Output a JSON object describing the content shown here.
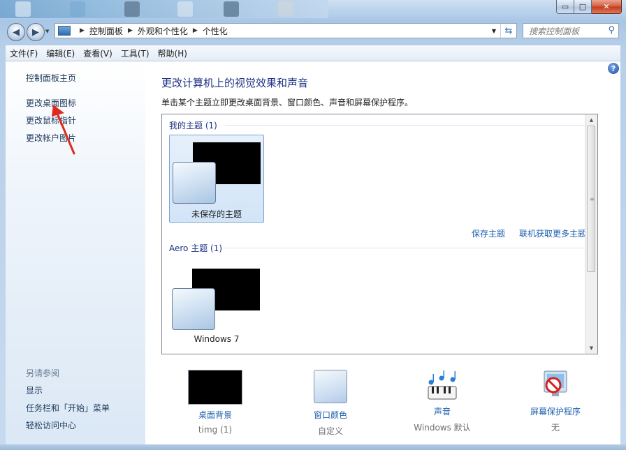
{
  "window": {
    "caption_buttons": {
      "minimize": "▭",
      "maximize": "□",
      "close": "✕"
    }
  },
  "navigation": {
    "back_icon": "◀",
    "forward_icon": "▶",
    "breadcrumbs": [
      "控制面板",
      "外观和个性化",
      "个性化"
    ],
    "search_placeholder": "搜索控制面板"
  },
  "menubar": {
    "items": [
      "文件(F)",
      "编辑(E)",
      "查看(V)",
      "工具(T)",
      "帮助(H)"
    ]
  },
  "sidebar": {
    "home": "控制面板主页",
    "links": [
      "更改桌面图标",
      "更改鼠标指针",
      "更改帐户图片"
    ],
    "see_also_header": "另请参阅",
    "see_also": [
      "显示",
      "任务栏和「开始」菜单",
      "轻松访问中心"
    ]
  },
  "main": {
    "title": "更改计算机上的视觉效果和声音",
    "description": "单击某个主题立即更改桌面背景、窗口颜色、声音和屏幕保护程序。",
    "my_themes": {
      "header": "我的主题 (1)",
      "themes": [
        {
          "label": "未保存的主题",
          "selected": true
        }
      ],
      "save_link": "保存主题",
      "online_link": "联机获取更多主题"
    },
    "aero_themes": {
      "header": "Aero 主题 (1)",
      "themes": [
        {
          "label": "Windows 7",
          "selected": false
        }
      ]
    },
    "help_icon": "?"
  },
  "bottom": [
    {
      "name": "桌面背景",
      "value": "timg (1)",
      "icon": "black-wallpaper-thumbnail"
    },
    {
      "name": "窗口颜色",
      "value": "自定义",
      "icon": "window-color-swatch"
    },
    {
      "name": "声音",
      "value": "Windows 默认",
      "icon": "music-notes-keyboard-icon"
    },
    {
      "name": "屏幕保护程序",
      "value": "无",
      "icon": "screensaver-none-icon"
    }
  ],
  "colors": {
    "link": "#1c5fae",
    "title": "#1e3287",
    "selection": "#d2e4f8"
  }
}
